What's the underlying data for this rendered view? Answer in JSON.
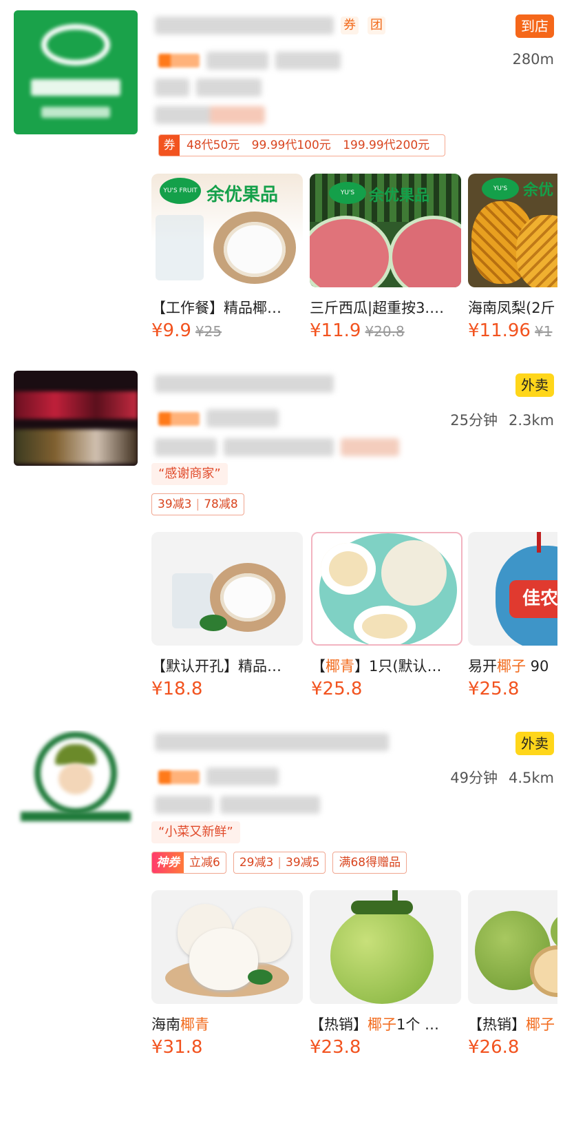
{
  "stores": [
    {
      "shop_tag": "到店",
      "head_icons": [
        "券",
        "团"
      ],
      "distance": "280m",
      "voucher": {
        "icon": "券",
        "items": [
          "48代50元",
          "99.99代100元",
          "199.99代200元"
        ]
      },
      "products": [
        {
          "name_pre": "【工作餐】精品椰…",
          "name_hl": "",
          "name_post": "",
          "price": "¥9.9",
          "old_price": "¥25",
          "brand": "余优果品",
          "brand_en": "YU'S FRUIT"
        },
        {
          "name_pre": "三斤西瓜|超重按3.…",
          "name_hl": "",
          "name_post": "",
          "price": "¥11.9",
          "old_price": "¥20.8",
          "brand": "余优果品",
          "brand_en": "YU'S"
        },
        {
          "name_pre": "海南凤梨(2斤",
          "name_hl": "",
          "name_post": "",
          "price": "¥11.96",
          "old_price": "¥1",
          "brand": "余优",
          "brand_en": "YU'S"
        }
      ]
    },
    {
      "shop_tag": "外卖",
      "time": "25分钟",
      "distance": "2.3km",
      "quote": "“感谢商家”",
      "discounts": [
        {
          "a": "39减3",
          "b": "78减8"
        }
      ],
      "products": [
        {
          "name_pre": "【默认开孔】精品…",
          "name_hl": "",
          "name_post": "",
          "price": "¥18.8",
          "old_price": ""
        },
        {
          "name_pre": "【",
          "name_hl": "椰青",
          "name_post": "】1只(默认…",
          "price": "¥25.8",
          "old_price": ""
        },
        {
          "name_pre": "易开",
          "name_hl": "椰子",
          "name_post": " 90",
          "price": "¥25.8",
          "old_price": "",
          "brand": "佳农"
        }
      ]
    },
    {
      "shop_tag": "外卖",
      "time": "49分钟",
      "distance": "4.5km",
      "quote": "“小菜又新鲜”",
      "god_coupon": {
        "label": "神券",
        "text": "立减6"
      },
      "discounts": [
        {
          "a": "29减3",
          "b": "39减5"
        }
      ],
      "gift": "满68得赠品",
      "products": [
        {
          "name_pre": "海南",
          "name_hl": "椰青",
          "name_post": "",
          "price": "¥31.8",
          "old_price": ""
        },
        {
          "name_pre": "【热销】",
          "name_hl": "椰子",
          "name_post": "1个 …",
          "price": "¥23.8",
          "old_price": ""
        },
        {
          "name_pre": "【热销】",
          "name_hl": "椰子",
          "name_post": "",
          "price": "¥26.8",
          "old_price": ""
        }
      ]
    }
  ]
}
